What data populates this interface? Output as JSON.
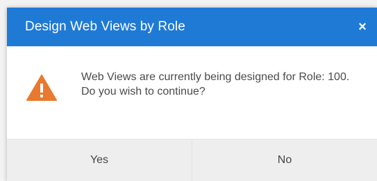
{
  "dialog": {
    "title": "Design Web Views by Role",
    "close_symbol": "×",
    "icon": "warning-icon",
    "message": "Web Views are currently being designed for Role: 100. Do you wish to continue?",
    "buttons": {
      "yes": "Yes",
      "no": "No"
    }
  },
  "colors": {
    "header": "#1f7ad6",
    "warning": "#e8792e",
    "footer": "#eeeeee"
  }
}
